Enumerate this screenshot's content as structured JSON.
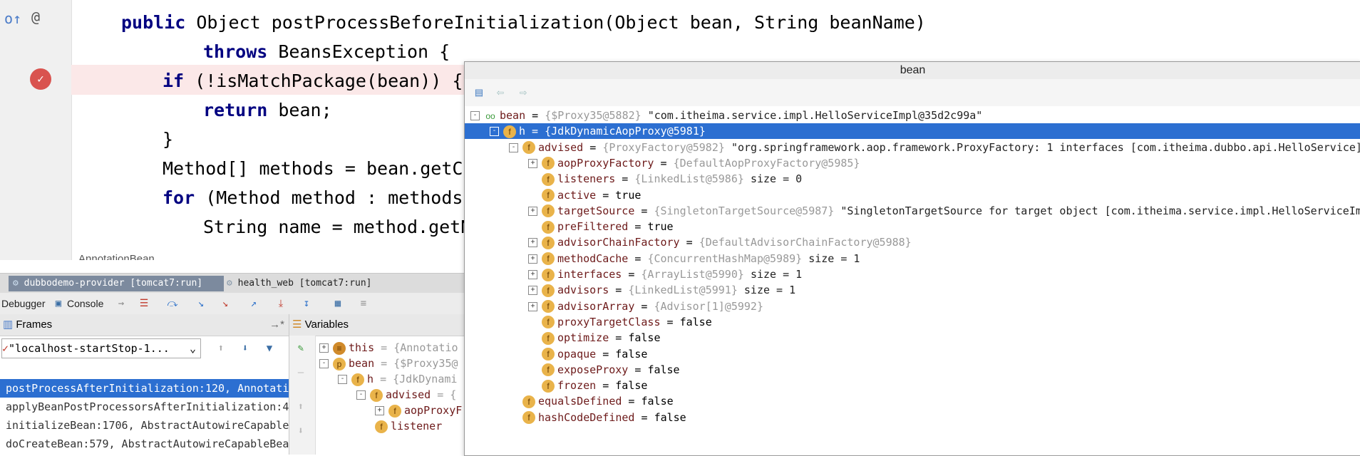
{
  "editor": {
    "lines": [
      {
        "indent": 0,
        "parts": [
          {
            "t": "public ",
            "k": 1
          },
          {
            "t": "Object postProcessBeforeInitialization(Object bean, String beanName)",
            "k": 0
          }
        ]
      },
      {
        "indent": 2,
        "parts": [
          {
            "t": "throws ",
            "k": 1
          },
          {
            "t": "BeansException {",
            "k": 0
          }
        ]
      },
      {
        "indent": 1,
        "parts": [
          {
            "t": "if ",
            "k": 1
          },
          {
            "t": "(!isMatchPackage(bean)) {",
            "k": 0
          }
        ]
      },
      {
        "indent": 2,
        "parts": [
          {
            "t": "return ",
            "k": 1
          },
          {
            "t": "bean;",
            "k": 0
          }
        ]
      },
      {
        "indent": 1,
        "parts": [
          {
            "t": "}",
            "k": 0
          }
        ]
      },
      {
        "indent": 1,
        "parts": [
          {
            "t": "Method[] methods = bean.getCl",
            "k": 0
          }
        ]
      },
      {
        "indent": 1,
        "parts": [
          {
            "t": "for ",
            "k": 1
          },
          {
            "t": "(Method method : methods)",
            "k": 0
          }
        ]
      },
      {
        "indent": 2,
        "parts": [
          {
            "t": "String name = method.getN",
            "k": 0
          }
        ]
      }
    ],
    "file_label": "AnnotationBean"
  },
  "run_tabs": [
    "dubbodemo-provider [tomcat7:run]",
    "health_web [tomcat7:run]"
  ],
  "debug_toolbar": {
    "debugger": "Debugger",
    "console": "Console"
  },
  "frames": {
    "title": "Frames",
    "thread": "\"localhost-startStop-1...",
    "rows": [
      "postProcessAfterInitialization:120, Annotati",
      "applyBeanPostProcessorsAfterInitialization:4",
      "initializeBean:1706, AbstractAutowireCapable",
      "doCreateBean:579, AbstractAutowireCapableBea"
    ]
  },
  "variables": {
    "title": "Variables",
    "rows": [
      {
        "depth": 0,
        "exp": "+",
        "badge": "this",
        "name": "this",
        "val": "= {Annotatio"
      },
      {
        "depth": 0,
        "exp": "-",
        "badge": "p",
        "name": "bean",
        "val": "= {$Proxy35@"
      },
      {
        "depth": 1,
        "exp": "-",
        "badge": "f",
        "name": "h",
        "val": "= {JdkDynami"
      },
      {
        "depth": 2,
        "exp": "-",
        "badge": "f",
        "name": "advised",
        "val": "= {"
      },
      {
        "depth": 3,
        "exp": "+",
        "badge": "f",
        "name": "aopProxyF",
        "val": ""
      },
      {
        "depth": 3,
        "exp": "",
        "badge": "f",
        "name": "listener",
        "val": ""
      }
    ]
  },
  "popup": {
    "title": "bean",
    "rows": [
      {
        "depth": 0,
        "exp": "-",
        "badge": "oo",
        "name": "bean",
        "type": "{$Proxy35@5882}",
        "extra": "\"com.itheima.service.impl.HelloServiceImpl@35d2c99a\"",
        "sel": false
      },
      {
        "depth": 1,
        "exp": "-",
        "badge": "f",
        "name": "h",
        "type": "{JdkDynamicAopProxy@5981}",
        "extra": "",
        "sel": true
      },
      {
        "depth": 2,
        "exp": "-",
        "badge": "f",
        "name": "advised",
        "type": "{ProxyFactory@5982}",
        "extra": "\"org.springframework.aop.framework.ProxyFactory: 1 interfaces [com.itheima.dubbo.api.HelloService]",
        "sel": false
      },
      {
        "depth": 3,
        "exp": "+",
        "badge": "f",
        "name": "aopProxyFactory",
        "type": "{DefaultAopProxyFactory@5985}",
        "extra": "",
        "sel": false
      },
      {
        "depth": 3,
        "exp": "",
        "badge": "f",
        "name": "listeners",
        "type": "{LinkedList@5986}",
        "extra": "size = 0",
        "sel": false
      },
      {
        "depth": 3,
        "exp": "",
        "badge": "f",
        "name": "active",
        "type": "",
        "extra": "true",
        "sel": false
      },
      {
        "depth": 3,
        "exp": "+",
        "badge": "f",
        "name": "targetSource",
        "type": "{SingletonTargetSource@5987}",
        "extra": "\"SingletonTargetSource for target object [com.itheima.service.impl.HelloServiceIm",
        "sel": false
      },
      {
        "depth": 3,
        "exp": "",
        "badge": "f",
        "name": "preFiltered",
        "type": "",
        "extra": "true",
        "sel": false
      },
      {
        "depth": 3,
        "exp": "+",
        "badge": "f",
        "name": "advisorChainFactory",
        "type": "{DefaultAdvisorChainFactory@5988}",
        "extra": "",
        "sel": false
      },
      {
        "depth": 3,
        "exp": "+",
        "badge": "f",
        "name": "methodCache",
        "type": "{ConcurrentHashMap@5989}",
        "extra": "size = 1",
        "sel": false
      },
      {
        "depth": 3,
        "exp": "+",
        "badge": "f",
        "name": "interfaces",
        "type": "{ArrayList@5990}",
        "extra": "size = 1",
        "sel": false
      },
      {
        "depth": 3,
        "exp": "+",
        "badge": "f",
        "name": "advisors",
        "type": "{LinkedList@5991}",
        "extra": "size = 1",
        "sel": false
      },
      {
        "depth": 3,
        "exp": "+",
        "badge": "f",
        "name": "advisorArray",
        "type": "{Advisor[1]@5992}",
        "extra": "",
        "sel": false
      },
      {
        "depth": 3,
        "exp": "",
        "badge": "f",
        "name": "proxyTargetClass",
        "type": "",
        "extra": "false",
        "sel": false
      },
      {
        "depth": 3,
        "exp": "",
        "badge": "f",
        "name": "optimize",
        "type": "",
        "extra": "false",
        "sel": false
      },
      {
        "depth": 3,
        "exp": "",
        "badge": "f",
        "name": "opaque",
        "type": "",
        "extra": "false",
        "sel": false
      },
      {
        "depth": 3,
        "exp": "",
        "badge": "f",
        "name": "exposeProxy",
        "type": "",
        "extra": "false",
        "sel": false
      },
      {
        "depth": 3,
        "exp": "",
        "badge": "f",
        "name": "frozen",
        "type": "",
        "extra": "false",
        "sel": false
      },
      {
        "depth": 2,
        "exp": "",
        "badge": "f",
        "name": "equalsDefined",
        "type": "",
        "extra": "false",
        "sel": false
      },
      {
        "depth": 2,
        "exp": "",
        "badge": "f",
        "name": "hashCodeDefined",
        "type": "",
        "extra": "false",
        "sel": false
      }
    ]
  },
  "colors": {
    "selection": "#2c6fd1",
    "breakpoint_line": "#fbe8e8",
    "keyword": "#000080",
    "field_badge": "#e9b34a"
  }
}
